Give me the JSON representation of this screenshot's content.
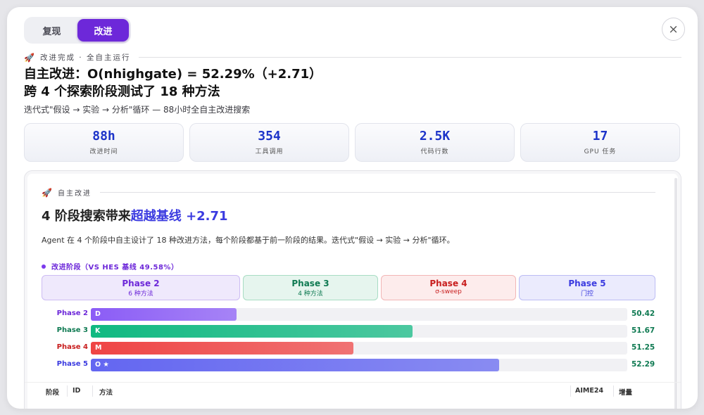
{
  "tabs": [
    {
      "label": "复现",
      "active": false
    },
    {
      "label": "改进",
      "active": true
    }
  ],
  "close_label": "×",
  "header": {
    "eyebrow_icon": "🚀",
    "eyebrow": "改进完成 · 全自主运行",
    "title_line1": "自主改进：O(nhighgate) = 52.29%（+2.71）",
    "title_line2": "跨 4 个探索阶段测试了 18 种方法",
    "subtitle": "迭代式\"假设 → 实验 → 分析\"循环 — 88小时全自主改进搜索"
  },
  "stats": [
    {
      "value": "88h",
      "label": "改进时间"
    },
    {
      "value": "354",
      "label": "工具调用"
    },
    {
      "value": "2.5K",
      "label": "代码行数"
    },
    {
      "value": "17",
      "label": "GPU 任务"
    }
  ],
  "card": {
    "eyebrow_icon": "🚀",
    "eyebrow": "自主改进",
    "title_prefix": "4 阶段搜索带来",
    "title_highlight": "超越基线 +2.71",
    "desc": "Agent 在 4 个阶段中自主设计了 18 种改进方法，每个阶段都基于前一阶段的结果。迭代式\"假设 → 实验 → 分析\"循环。",
    "legend": "改进阶段（VS HES 基线 49.58%）"
  },
  "phases": [
    {
      "name": "Phase 2",
      "sub": "6 种方法",
      "color": "#6d28d9",
      "bg": "#efe9fc",
      "border": "#cdbcf3"
    },
    {
      "name": "Phase 3",
      "sub": "4 种方法",
      "color": "#0f7a52",
      "bg": "#e6f5ee",
      "border": "#a8dcc3"
    },
    {
      "name": "Phase 4",
      "sub": "σ-sweep",
      "color": "#c81e1e",
      "bg": "#fdecec",
      "border": "#f2b6b6"
    },
    {
      "name": "Phase 5",
      "sub": "门控",
      "color": "#3b3be0",
      "bg": "#ebebfd",
      "border": "#bcbcf4"
    }
  ],
  "chart_data": {
    "type": "bar",
    "orientation": "horizontal",
    "categories": [
      "Phase 2",
      "Phase 3",
      "Phase 4",
      "Phase 5"
    ],
    "bar_labels": [
      "D",
      "K",
      "M",
      "O ★"
    ],
    "values": [
      50.42,
      51.67,
      51.25,
      52.29
    ],
    "baseline": 49.58,
    "colors": [
      "#8b5cf6",
      "#10b981",
      "#ef4444",
      "#6366f1"
    ],
    "label_colors": [
      "#6d28d9",
      "#0f7a52",
      "#c81e1e",
      "#3b3be0"
    ]
  },
  "table": {
    "headers": [
      "阶段",
      "ID",
      "方法",
      "AIME24",
      "增量"
    ]
  }
}
